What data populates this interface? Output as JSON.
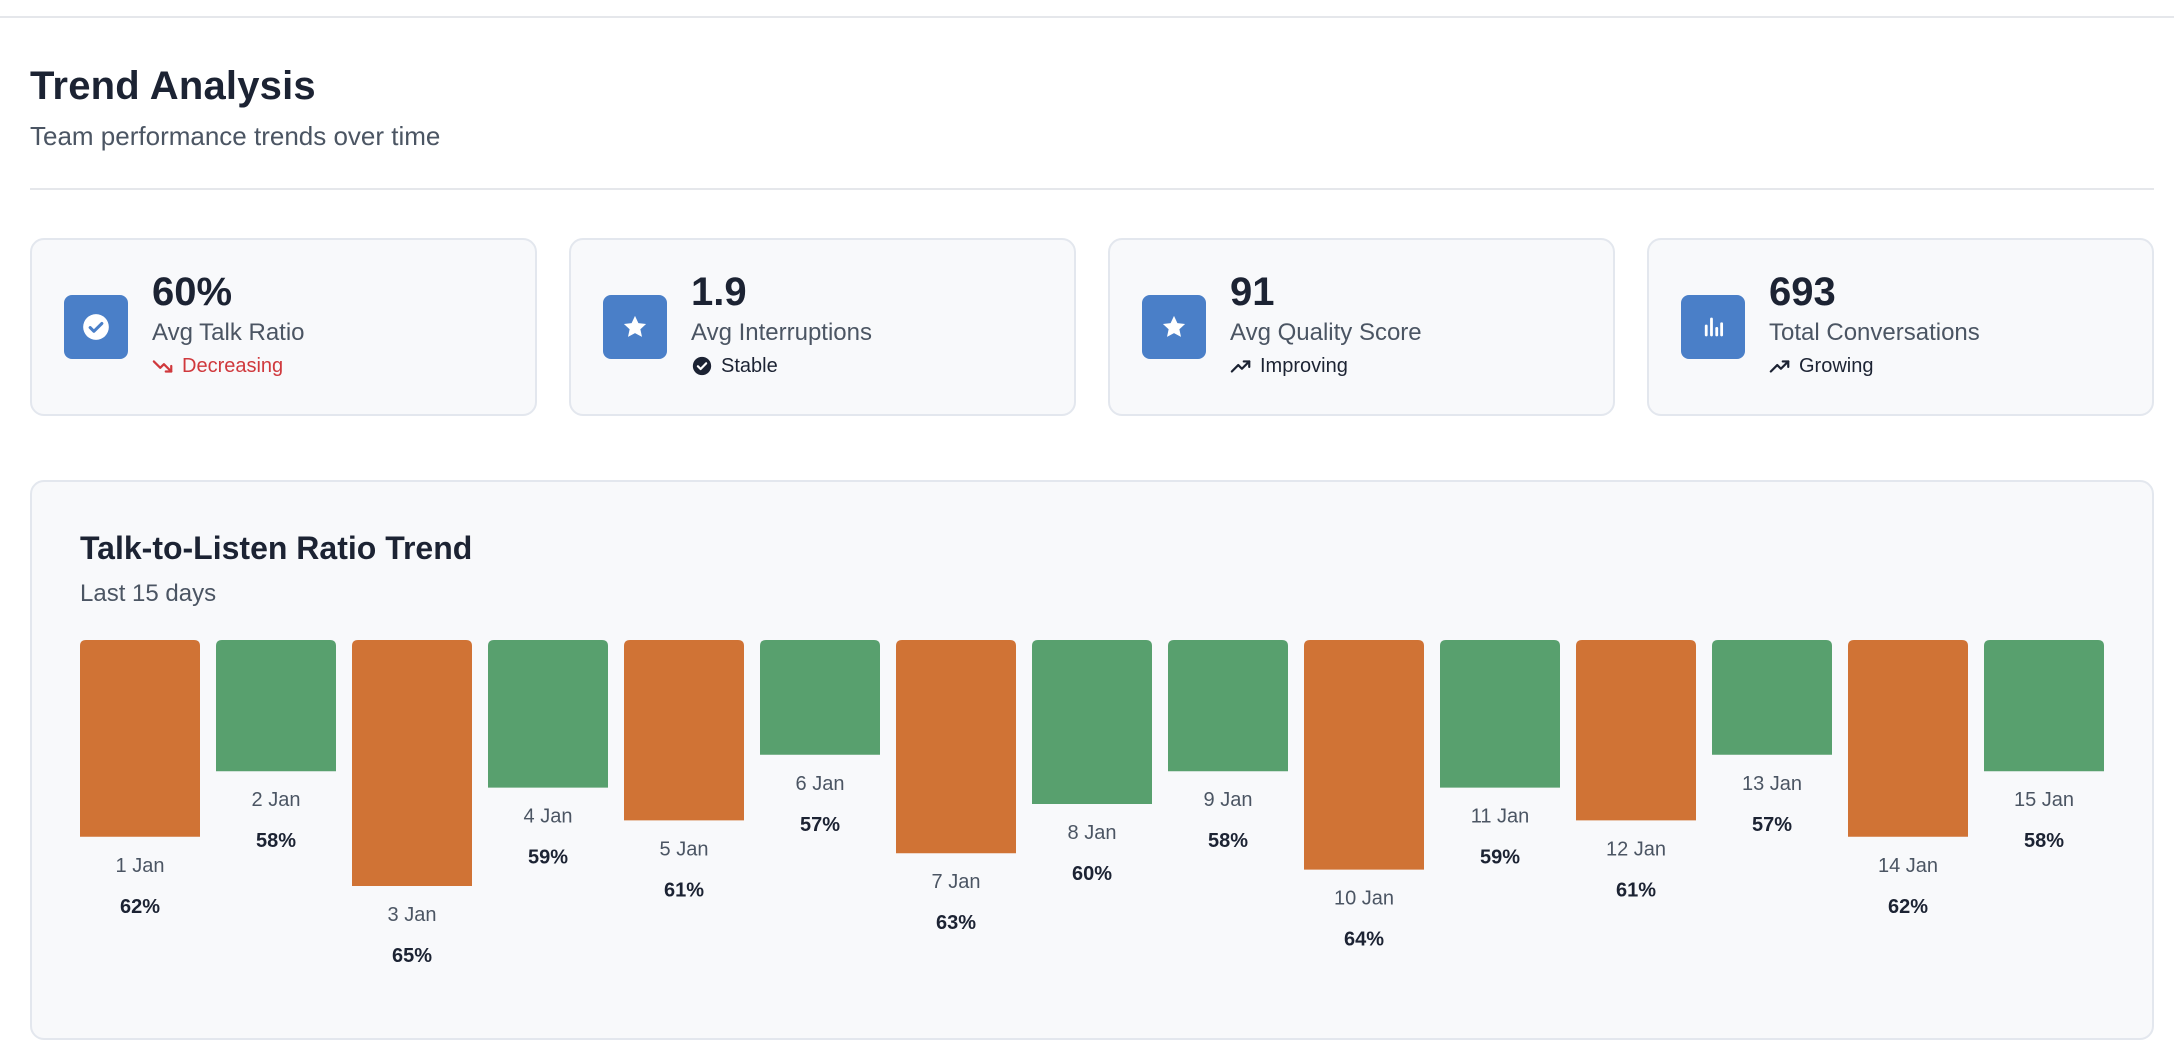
{
  "header": {
    "title": "Trend Analysis",
    "subtitle": "Team performance trends over time"
  },
  "cards": [
    {
      "value": "60%",
      "label": "Avg Talk Ratio",
      "trend": "Decreasing",
      "icon": "check-circle-icon",
      "trend_icon": "trending-down-icon",
      "trend_color": "#d0393d"
    },
    {
      "value": "1.9",
      "label": "Avg Interruptions",
      "trend": "Stable",
      "icon": "star-icon",
      "trend_icon": "check-circle-icon",
      "trend_color": "#1c2333"
    },
    {
      "value": "91",
      "label": "Avg Quality Score",
      "trend": "Improving",
      "icon": "star-icon",
      "trend_icon": "trending-up-icon",
      "trend_color": "#1c2333"
    },
    {
      "value": "693",
      "label": "Total Conversations",
      "trend": "Growing",
      "icon": "bar-chart-icon",
      "trend_icon": "trending-up-icon",
      "trend_color": "#1c2333"
    }
  ],
  "colors": {
    "accent": "#4a7fc8",
    "bar_high": "#d07335",
    "bar_low": "#58a06e"
  },
  "chart_data": {
    "type": "bar",
    "title": "Talk-to-Listen Ratio Trend",
    "subtitle": "Last 15 days",
    "categories": [
      "1 Jan",
      "2 Jan",
      "3 Jan",
      "4 Jan",
      "5 Jan",
      "6 Jan",
      "7 Jan",
      "8 Jan",
      "9 Jan",
      "10 Jan",
      "11 Jan",
      "12 Jan",
      "13 Jan",
      "14 Jan",
      "15 Jan"
    ],
    "values": [
      62,
      58,
      65,
      59,
      61,
      57,
      63,
      60,
      58,
      64,
      59,
      61,
      57,
      62,
      58
    ],
    "value_labels": [
      "62%",
      "58%",
      "65%",
      "59%",
      "61%",
      "57%",
      "63%",
      "60%",
      "58%",
      "64%",
      "59%",
      "61%",
      "57%",
      "62%",
      "58%"
    ],
    "color_rule": "values above 60 orange, 60 or below green",
    "threshold": 60,
    "grid": false,
    "legend": "none"
  }
}
